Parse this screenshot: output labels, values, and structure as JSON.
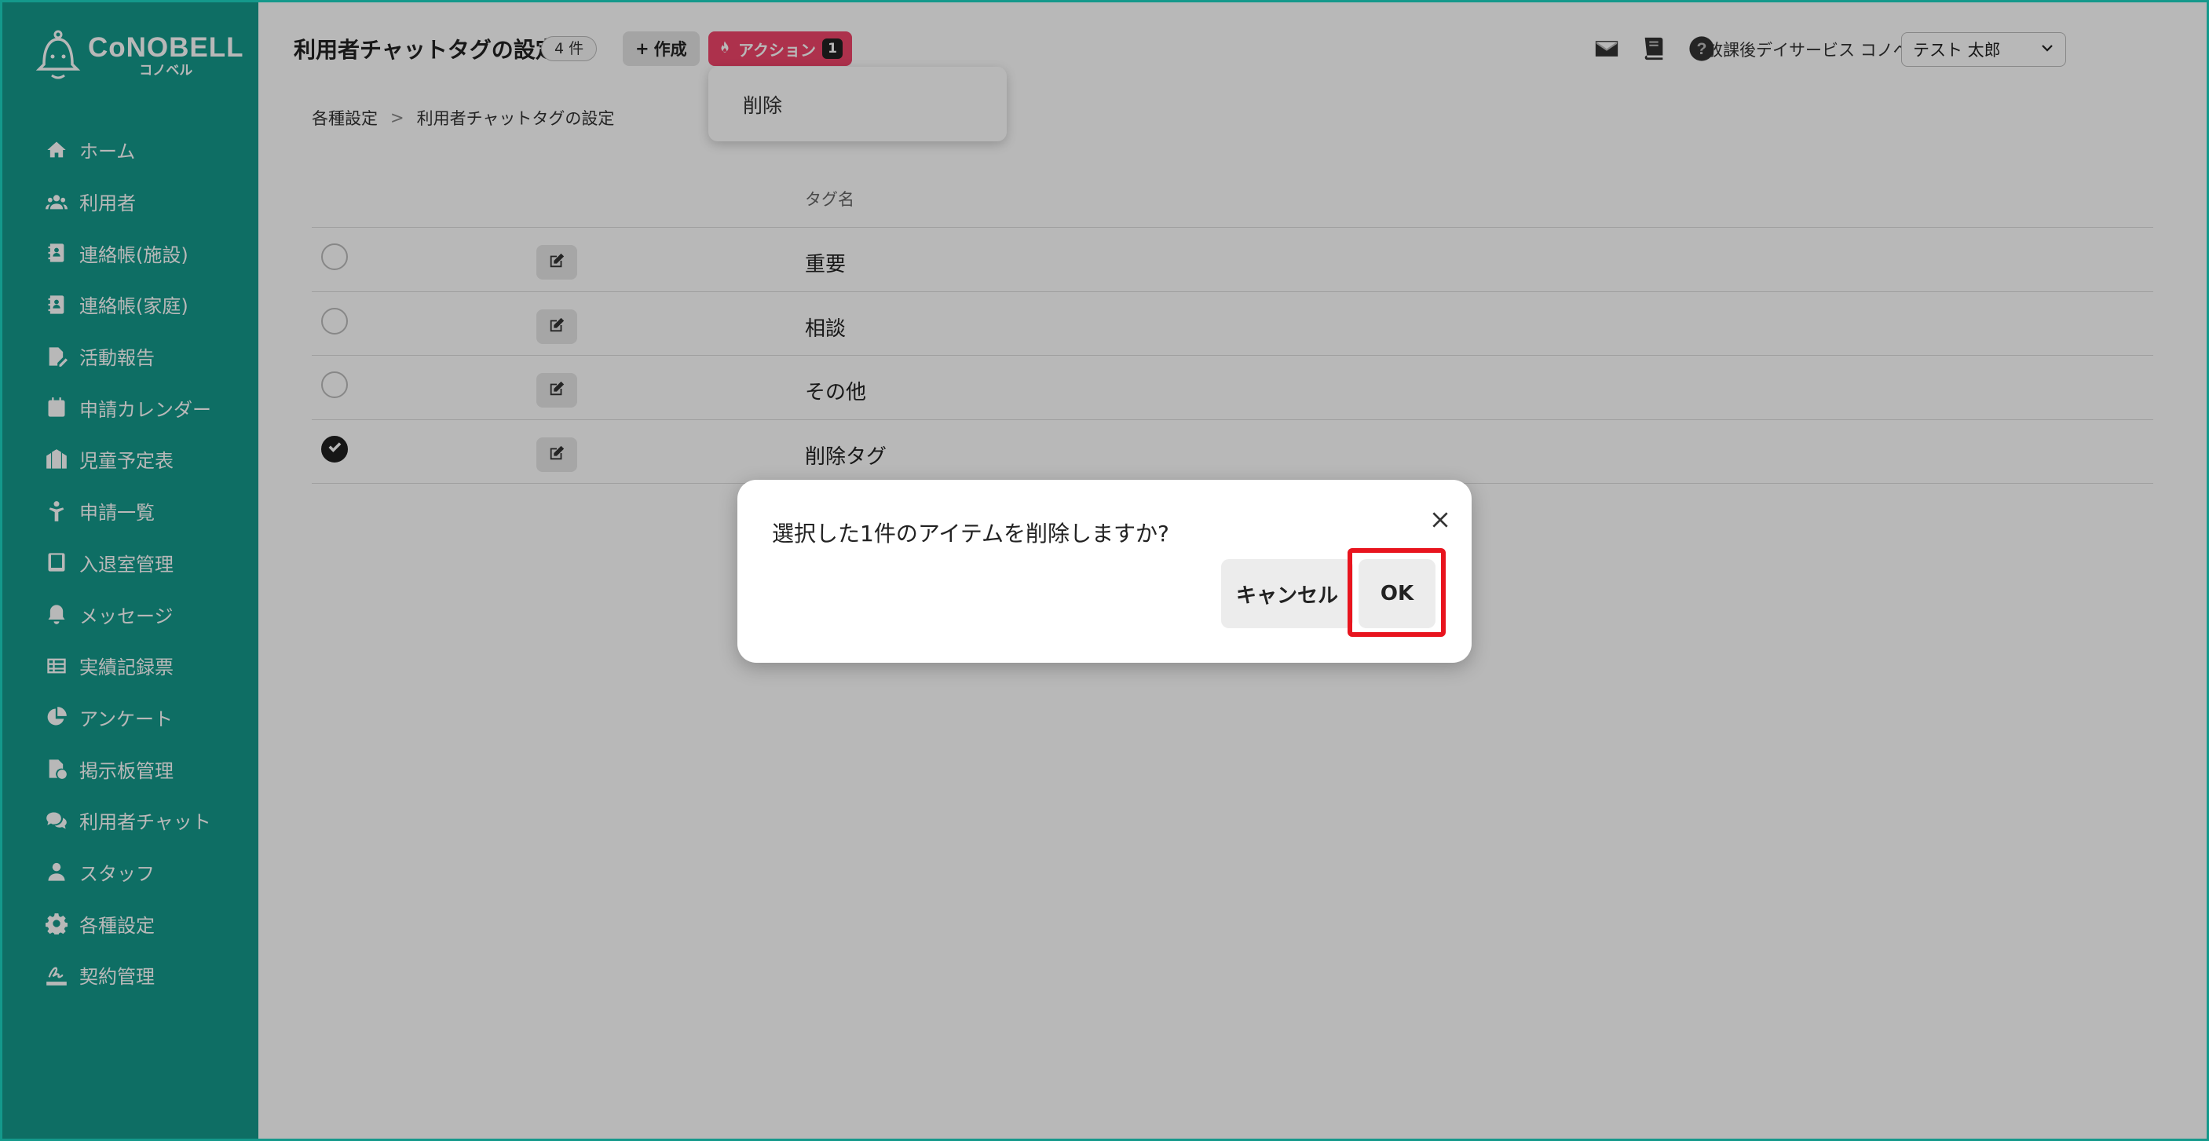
{
  "brand": {
    "name": "CoNOBELL",
    "sub": "コノベル",
    "accent": "#14998b"
  },
  "sidebar": {
    "items": [
      {
        "label": "ホーム",
        "icon": "home-icon"
      },
      {
        "label": "利用者",
        "icon": "users-icon"
      },
      {
        "label": "連絡帳(施設)",
        "icon": "contact-book-icon"
      },
      {
        "label": "連絡帳(家庭)",
        "icon": "contact-book-icon"
      },
      {
        "label": "活動報告",
        "icon": "file-edit-icon"
      },
      {
        "label": "申請カレンダー",
        "icon": "calendar-icon"
      },
      {
        "label": "児童予定表",
        "icon": "schedule-icon"
      },
      {
        "label": "申請一覧",
        "icon": "child-icon"
      },
      {
        "label": "入退室管理",
        "icon": "tablet-icon"
      },
      {
        "label": "メッセージ",
        "icon": "bell-icon"
      },
      {
        "label": "実績記録票",
        "icon": "table-icon"
      },
      {
        "label": "アンケート",
        "icon": "pie-chart-icon"
      },
      {
        "label": "掲示板管理",
        "icon": "file-check-icon"
      },
      {
        "label": "利用者チャット",
        "icon": "chat-icon"
      },
      {
        "label": "スタッフ",
        "icon": "staff-icon"
      },
      {
        "label": "各種設定",
        "icon": "gear-icon"
      },
      {
        "label": "契約管理",
        "icon": "signature-icon"
      }
    ]
  },
  "header": {
    "title": "利用者チャットタグの設定",
    "count": "4 件",
    "create_label": "作成",
    "action_label": "アクション",
    "action_count": "1",
    "facility": "放課後デイサービス コノベル",
    "user": "テスト 太郎"
  },
  "dropdown": {
    "item": "削除"
  },
  "breadcrumb": {
    "parent": "各種設定",
    "separator": ">",
    "current": "利用者チャットタグの設定"
  },
  "table": {
    "column": "タグ名",
    "rows": [
      {
        "name": "重要",
        "checked": false
      },
      {
        "name": "相談",
        "checked": false
      },
      {
        "name": "その他",
        "checked": false
      },
      {
        "name": "削除タグ",
        "checked": true
      }
    ]
  },
  "modal": {
    "message": "選択した1件のアイテムを削除しますか?",
    "cancel_label": "キャンセル",
    "ok_label": "OK",
    "highlight_color": "#e8141e"
  }
}
